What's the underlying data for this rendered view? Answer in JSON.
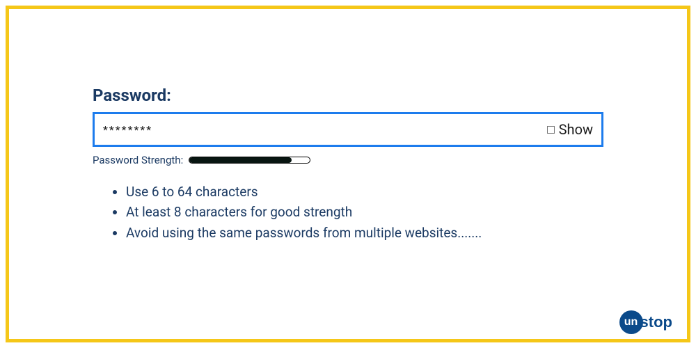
{
  "field": {
    "label": "Password:",
    "masked_value": "********",
    "show_label": "Show"
  },
  "strength": {
    "label": "Password Strength:",
    "fill_percent": 85
  },
  "tips": [
    "Use 6 to 64 characters",
    "At least 8 characters for good strength",
    "Avoid using the same passwords from multiple websites......."
  ],
  "branding": {
    "logo_bubble": "un",
    "logo_rest": "stop"
  }
}
